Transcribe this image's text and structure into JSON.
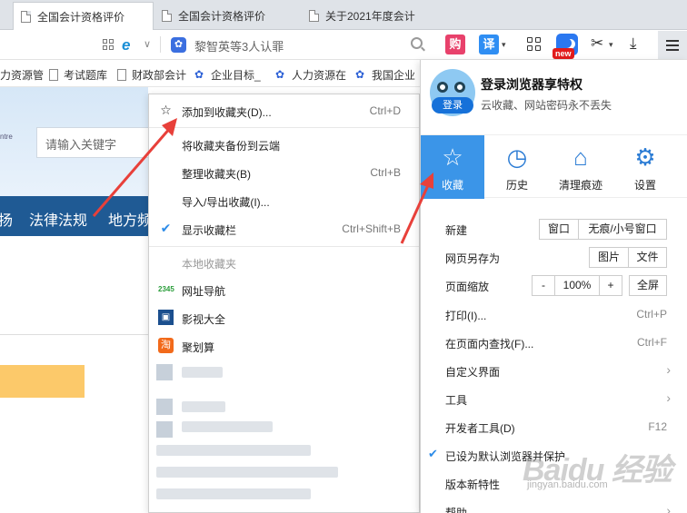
{
  "tabs": [
    {
      "title": "全国会计资格评价",
      "active": true
    },
    {
      "title": "全国会计资格评价",
      "active": false
    },
    {
      "title": "关于2021年度会计",
      "active": false
    }
  ],
  "address": {
    "search_query": "黎智英等3人认罪",
    "ext_gou": "购",
    "ext_yi": "译",
    "new_badge": "new"
  },
  "bookmarks_bar": [
    {
      "label": "力资源管",
      "icon": "page-icon"
    },
    {
      "label": "考试题库",
      "icon": "page-icon"
    },
    {
      "label": "财政部会计",
      "icon": "page-icon"
    },
    {
      "label": "企业目标_",
      "icon": "paw-icon"
    },
    {
      "label": "人力资源在",
      "icon": "paw-icon"
    },
    {
      "label": "我国企业",
      "icon": "paw-icon"
    }
  ],
  "page": {
    "small_text": "ntre",
    "search_placeholder": "请输入关键字",
    "nav": [
      "扬",
      "法律法规",
      "地方频"
    ]
  },
  "fav_menu": {
    "items": [
      {
        "label": "添加到收藏夹(D)...",
        "shortcut": "Ctrl+D",
        "icon": "star-icon"
      },
      {
        "label": "将收藏夹备份到云端",
        "shortcut": ""
      },
      {
        "label": "整理收藏夹(B)",
        "shortcut": "Ctrl+B"
      },
      {
        "label": "导入/导出收藏(I)...",
        "shortcut": ""
      },
      {
        "label": "显示收藏栏",
        "shortcut": "Ctrl+Shift+B",
        "checked": true
      }
    ],
    "section_title": "本地收藏夹",
    "local": [
      {
        "label": "网址导航",
        "icon": "2345-icon"
      },
      {
        "label": "影视大全",
        "icon": "film-icon"
      },
      {
        "label": "聚划算",
        "icon": "taobao-icon"
      }
    ]
  },
  "main_menu": {
    "login_title": "登录浏览器享特权",
    "login_sub": "云收藏、网站密码永不丢失",
    "login_btn": "登录",
    "quick": [
      {
        "label": "收藏",
        "icon": "star-icon",
        "active": true
      },
      {
        "label": "历史",
        "icon": "clock-icon",
        "active": false
      },
      {
        "label": "清理痕迹",
        "icon": "broom-icon",
        "active": false
      },
      {
        "label": "设置",
        "icon": "gear-icon",
        "active": false
      }
    ],
    "new_label": "新建",
    "new_window": "窗口",
    "new_private": "无痕/小号窗口",
    "saveas_label": "网页另存为",
    "saveas_image": "图片",
    "saveas_file": "文件",
    "zoom_label": "页面缩放",
    "zoom_minus": "-",
    "zoom_value": "100%",
    "zoom_plus": "+",
    "zoom_full": "全屏",
    "rows": [
      {
        "label": "打印(I)...",
        "shortcut": "Ctrl+P"
      },
      {
        "label": "在页面内查找(F)...",
        "shortcut": "Ctrl+F"
      },
      {
        "label": "自定义界面",
        "shortcut": "",
        "submenu": true
      },
      {
        "label": "工具",
        "shortcut": "",
        "submenu": true
      },
      {
        "label": "开发者工具(D)",
        "shortcut": "F12"
      },
      {
        "label": "已设为默认浏览器并保护",
        "shortcut": "",
        "checked": true
      },
      {
        "label": "版本新特性",
        "shortcut": ""
      },
      {
        "label": "帮助",
        "shortcut": "",
        "submenu": true
      }
    ]
  },
  "watermark": {
    "main": "Baidu 经验",
    "sub": "jingyan.baidu.com"
  }
}
